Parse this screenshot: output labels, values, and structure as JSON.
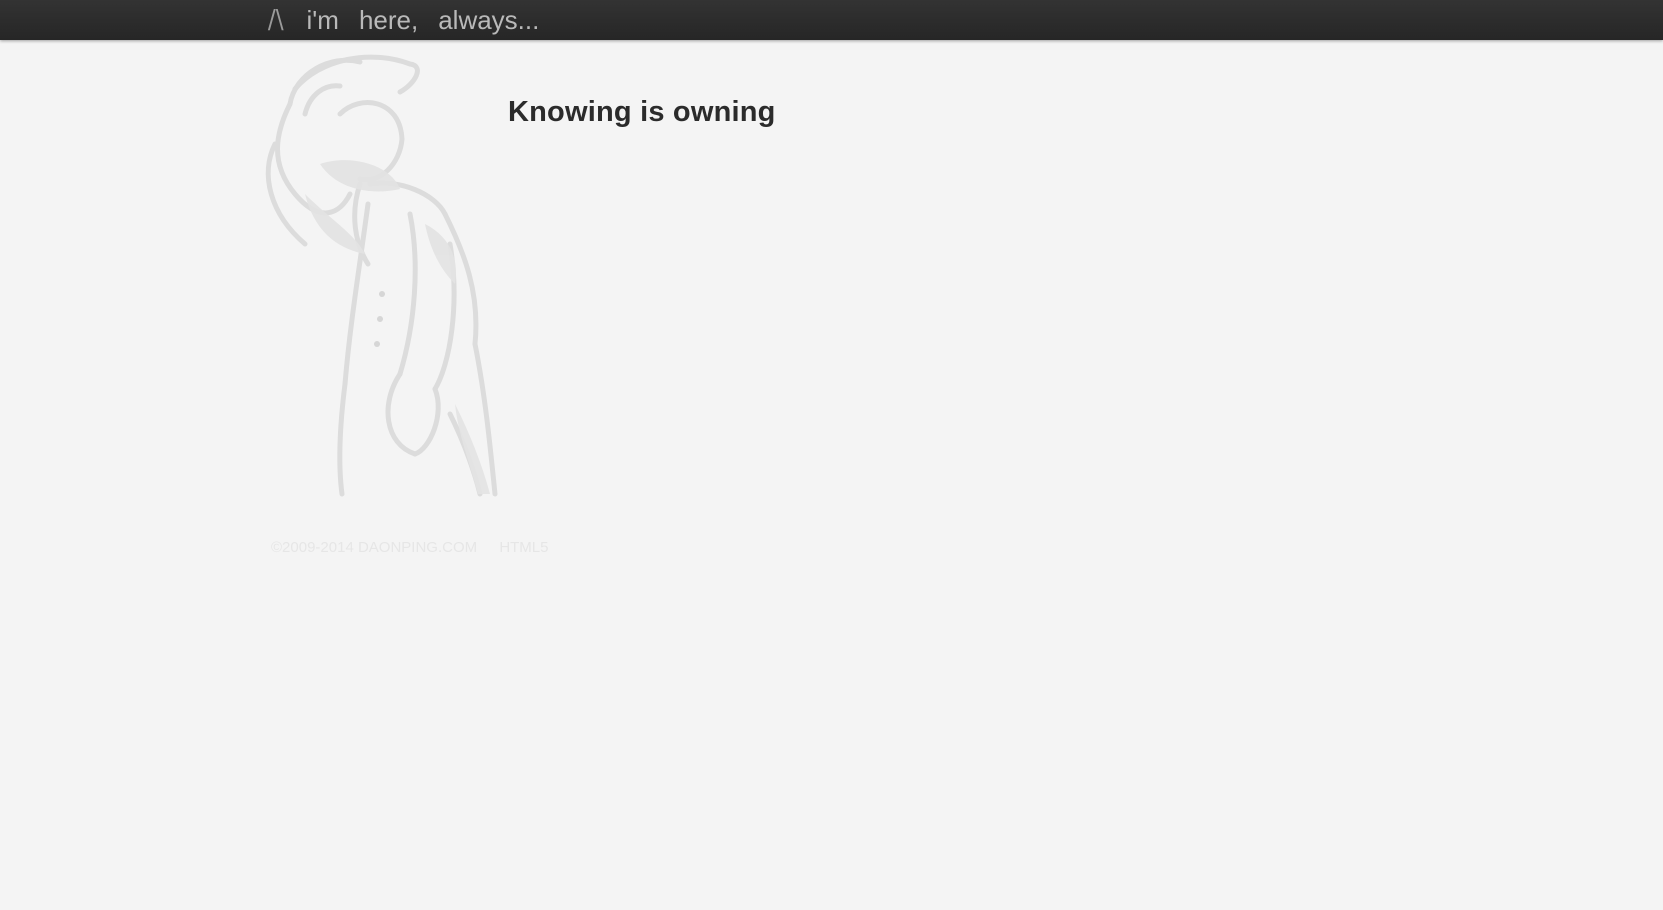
{
  "nav": {
    "home_label": "/\\",
    "links": [
      "i'm",
      "here,",
      "always..."
    ]
  },
  "main": {
    "title": "Knowing is owning"
  },
  "footer": {
    "copyright": "©2009-2014 DAONPING.COM",
    "badge": "HTML5"
  },
  "colors": {
    "topbar": "#2d2d2d",
    "background": "#f4f4f4",
    "title": "#2b2b2b",
    "nav_text": "#b9b9b9",
    "sketch": "#dcdcdc"
  }
}
